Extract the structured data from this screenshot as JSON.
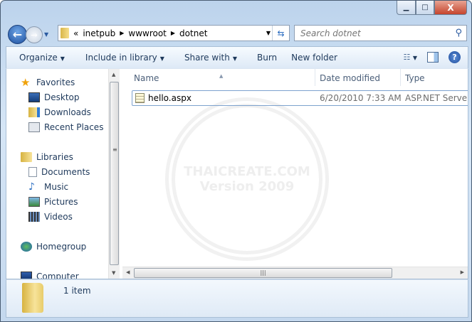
{
  "window": {
    "minimize": "▁",
    "maximize": "□",
    "close": "X"
  },
  "address": {
    "overflow": "«",
    "crumbs": [
      "inetpub",
      "wwwroot",
      "dotnet"
    ]
  },
  "search": {
    "placeholder": "Search dotnet"
  },
  "toolbar": {
    "organize": "Organize",
    "include": "Include in library",
    "share": "Share with",
    "burn": "Burn",
    "new_folder": "New folder",
    "help": "?"
  },
  "nav": {
    "favorites": "Favorites",
    "desktop": "Desktop",
    "downloads": "Downloads",
    "recent": "Recent Places",
    "libraries": "Libraries",
    "documents": "Documents",
    "music": "Music",
    "pictures": "Pictures",
    "videos": "Videos",
    "homegroup": "Homegroup",
    "computer": "Computer"
  },
  "columns": {
    "name": "Name",
    "date": "Date modified",
    "type": "Type"
  },
  "files": [
    {
      "name": "hello.aspx",
      "date": "6/20/2010 7:33 AM",
      "type": "ASP.NET Server Page"
    }
  ],
  "watermark": {
    "line1": "THAICREATE.COM",
    "line2": "Version 2009"
  },
  "status": {
    "count": "1 item"
  }
}
